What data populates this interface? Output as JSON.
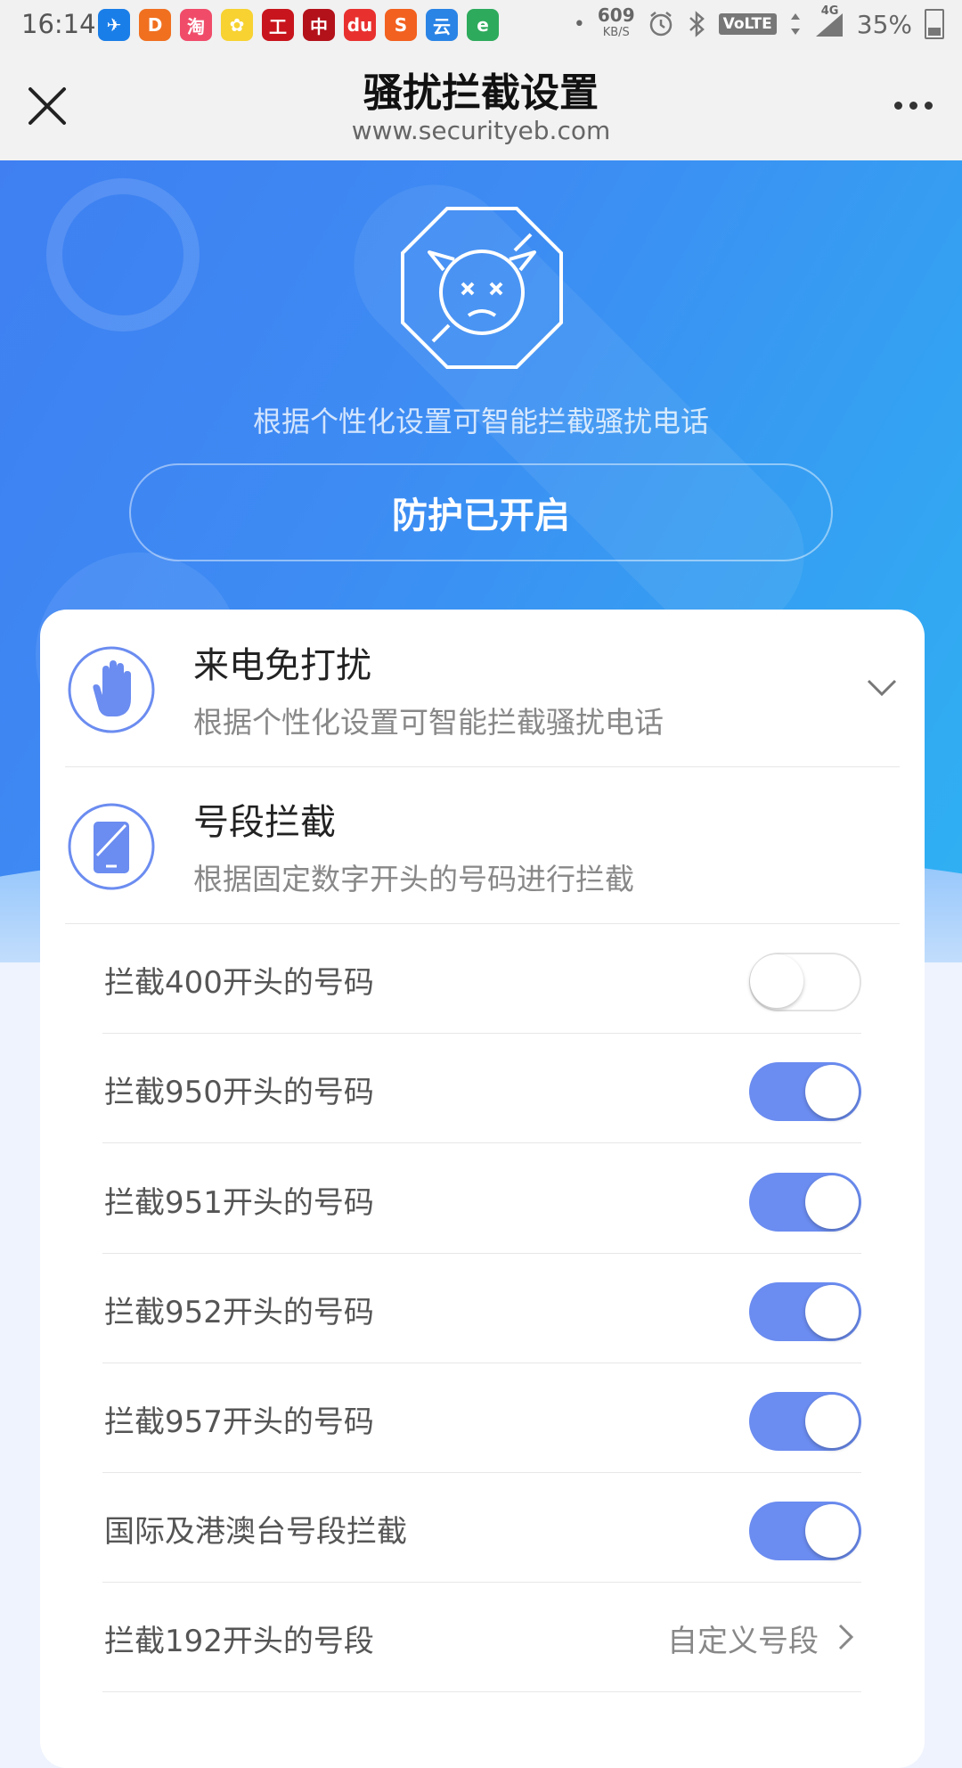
{
  "status_bar": {
    "time": "16:14",
    "net_speed": "609",
    "net_unit": "KB/S",
    "volte": "VoLTE",
    "network": "4G",
    "battery": "35%",
    "notif_icons": [
      {
        "name": "feather-app-icon",
        "color": "#1a7ee8",
        "glyph": "✈"
      },
      {
        "name": "didi-icon",
        "color": "#f07020",
        "glyph": "D"
      },
      {
        "name": "taobao-icon",
        "color": "#f04c6a",
        "glyph": "淘"
      },
      {
        "name": "rabbit-app-icon",
        "color": "#f7d231",
        "glyph": "✿"
      },
      {
        "name": "icbc-icon",
        "color": "#c8151d",
        "glyph": "工"
      },
      {
        "name": "boc-icon",
        "color": "#b3121b",
        "glyph": "中"
      },
      {
        "name": "baidu-map-icon",
        "color": "#e8312f",
        "glyph": "du"
      },
      {
        "name": "sogou-icon",
        "color": "#f2611f",
        "glyph": "S"
      },
      {
        "name": "cloud-app-icon",
        "color": "#2a84e6",
        "glyph": "云"
      },
      {
        "name": "edge-browser-icon",
        "color": "#2eaa5c",
        "glyph": "e"
      }
    ]
  },
  "header": {
    "title": "骚扰拦截设置",
    "url": "www.securityeb.com"
  },
  "hero": {
    "description": "根据个性化设置可智能拦截骚扰电话",
    "protect_button": "防护已开启"
  },
  "sections": [
    {
      "title": "来电免打扰",
      "desc": "根据个性化设置可智能拦截骚扰电话"
    },
    {
      "title": "号段拦截",
      "desc": "根据固定数字开头的号码进行拦截"
    }
  ],
  "rows": [
    {
      "label": "拦截400开头的号码",
      "toggle": false
    },
    {
      "label": "拦截950开头的号码",
      "toggle": true
    },
    {
      "label": "拦截951开头的号码",
      "toggle": true
    },
    {
      "label": "拦截952开头的号码",
      "toggle": true
    },
    {
      "label": "拦截957开头的号码",
      "toggle": true
    },
    {
      "label": "国际及港澳台号段拦截",
      "toggle": true
    }
  ],
  "custom_row": {
    "label": "拦截192开头的号段",
    "value": "自定义号段"
  },
  "colors": {
    "accent": "#6b8cf0",
    "hero_start": "#3f7ff2",
    "hero_end": "#2fb2f3"
  }
}
